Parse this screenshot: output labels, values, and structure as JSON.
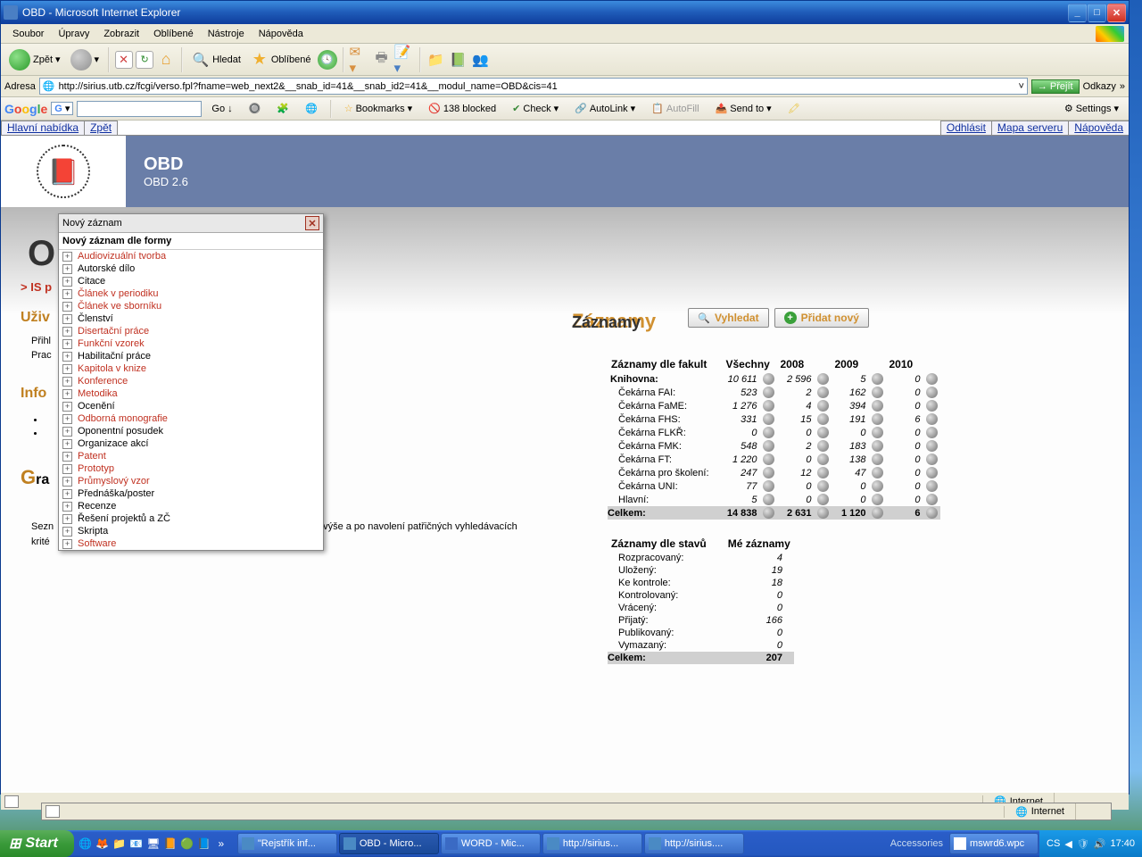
{
  "window": {
    "title": "OBD - Microsoft Internet Explorer"
  },
  "menubar": [
    "Soubor",
    "Úpravy",
    "Zobrazit",
    "Oblíbené",
    "Nástroje",
    "Nápověda"
  ],
  "toolbar": {
    "back": "Zpět",
    "search": "Hledat",
    "favorites": "Oblíbené"
  },
  "address": {
    "label": "Adresa",
    "url": "http://sirius.utb.cz/fcgi/verso.fpl?fname=web_next2&__snab_id=41&__snab_id2=41&__modul_name=OBD&cis=41",
    "go": "Přejít",
    "links": "Odkazy"
  },
  "google": {
    "go": "Go",
    "bookmarks": "Bookmarks",
    "blocked": "138 blocked",
    "check": "Check",
    "autolink": "AutoLink",
    "autofill": "AutoFill",
    "sendto": "Send to",
    "settings": "Settings"
  },
  "app": {
    "nav": {
      "main": "Hlavní nabídka",
      "back": "Zpět",
      "logout": "Odhlásit",
      "map": "Mapa serveru",
      "help": "Nápověda"
    },
    "banner": {
      "title": "OBD",
      "sub": "OBD 2.6"
    },
    "bg": {
      "big": "O",
      "is": "> IS p",
      "uziv": "Uživ",
      "prihl": "Přihl",
      "prac": "Prac",
      "info": "Info",
      "gra": "Gra",
      "sezn_prefix": "Sezn",
      "sezn_rest": "výše a po navolení patřičných vyhledávacích",
      "krit": "krité"
    }
  },
  "popup": {
    "title": "Nový záznam",
    "head": "Nový záznam dle formy",
    "items": [
      {
        "label": "Audiovizuální tvorba",
        "red": true
      },
      {
        "label": "Autorské dílo",
        "red": false
      },
      {
        "label": "Citace",
        "red": false
      },
      {
        "label": "Článek v periodiku",
        "red": true
      },
      {
        "label": "Článek ve sborníku",
        "red": true
      },
      {
        "label": "Členství",
        "red": false
      },
      {
        "label": "Disertační práce",
        "red": true
      },
      {
        "label": "Funkční vzorek",
        "red": true
      },
      {
        "label": "Habilitační práce",
        "red": false
      },
      {
        "label": "Kapitola v knize",
        "red": true
      },
      {
        "label": "Konference",
        "red": true
      },
      {
        "label": "Metodika",
        "red": true
      },
      {
        "label": "Ocenění",
        "red": false
      },
      {
        "label": "Odborná monografie",
        "red": true
      },
      {
        "label": "Oponentní posudek",
        "red": false
      },
      {
        "label": "Organizace akcí",
        "red": false
      },
      {
        "label": "Patent",
        "red": true
      },
      {
        "label": "Prototyp",
        "red": true
      },
      {
        "label": "Průmyslový vzor",
        "red": true
      },
      {
        "label": "Přednáška/poster",
        "red": false
      },
      {
        "label": "Recenze",
        "red": false
      },
      {
        "label": "Řešení projektů a ZČ",
        "red": false
      },
      {
        "label": "Skripta",
        "red": false
      },
      {
        "label": "Software",
        "red": true
      }
    ]
  },
  "records": {
    "heading_bg": "Záznamy",
    "heading": "Záznamy",
    "search": "Vyhledat",
    "add": "Přidat nový",
    "faculty_head": "Záznamy dle fakult",
    "cols": [
      "Všechny",
      "2008",
      "2009",
      "2010"
    ],
    "rows": [
      {
        "label": "Knihovna:",
        "bold": true,
        "vals": [
          "10 611",
          "2 596",
          "5",
          "0"
        ]
      },
      {
        "label": "Čekárna FAI:",
        "vals": [
          "523",
          "2",
          "162",
          "0"
        ]
      },
      {
        "label": "Čekárna FaME:",
        "vals": [
          "1 276",
          "4",
          "394",
          "0"
        ]
      },
      {
        "label": "Čekárna FHS:",
        "vals": [
          "331",
          "15",
          "191",
          "6"
        ]
      },
      {
        "label": "Čekárna FLKŘ:",
        "vals": [
          "0",
          "0",
          "0",
          "0"
        ]
      },
      {
        "label": "Čekárna FMK:",
        "vals": [
          "548",
          "2",
          "183",
          "0"
        ]
      },
      {
        "label": "Čekárna FT:",
        "vals": [
          "1 220",
          "0",
          "138",
          "0"
        ]
      },
      {
        "label": "Čekárna pro školení:",
        "vals": [
          "247",
          "12",
          "47",
          "0"
        ]
      },
      {
        "label": "Čekárna UNI:",
        "vals": [
          "77",
          "0",
          "0",
          "0"
        ]
      },
      {
        "label": "Hlavní:",
        "vals": [
          "5",
          "0",
          "0",
          "0"
        ]
      }
    ],
    "total": {
      "label": "Celkem:",
      "vals": [
        "14 838",
        "2 631",
        "1 120",
        "6"
      ]
    },
    "status_head": "Záznamy dle stavů",
    "mine_head": "Mé záznamy",
    "statuses": [
      {
        "label": "Rozpracovaný:",
        "val": "4"
      },
      {
        "label": "Uložený:",
        "val": "19"
      },
      {
        "label": "Ke kontrole:",
        "val": "18"
      },
      {
        "label": "Kontrolovaný:",
        "val": "0"
      },
      {
        "label": "Vrácený:",
        "val": "0"
      },
      {
        "label": "Přijatý:",
        "val": "166"
      },
      {
        "label": "Publikovaný:",
        "val": "0"
      },
      {
        "label": "Vymazaný:",
        "val": "0"
      }
    ],
    "status_total": {
      "label": "Celkem:",
      "val": "207"
    }
  },
  "status": {
    "zone": "Internet"
  },
  "taskbar": {
    "start": "Start",
    "accessories": "Accessories",
    "tasks": [
      "\"Rejstřík inf...",
      "OBD - Micro...",
      "WORD - Mic...",
      "http://sirius...",
      "http://sirius...."
    ],
    "tray_file": "mswrd6.wpc",
    "lang": "CS",
    "time": "17:40"
  }
}
